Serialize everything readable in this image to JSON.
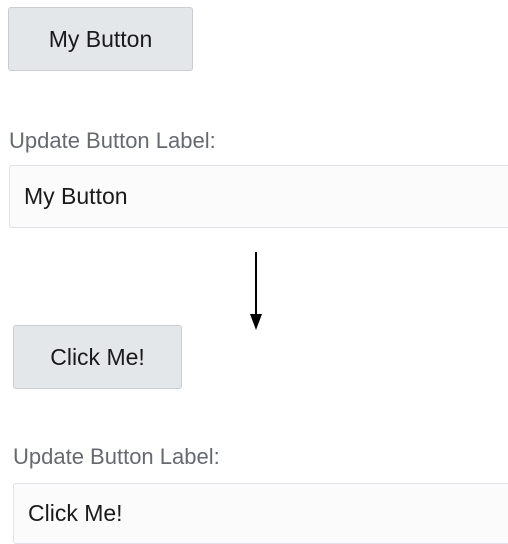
{
  "before": {
    "button_label": "My Button",
    "field_label": "Update Button Label:",
    "field_value": "My Button"
  },
  "after": {
    "button_label": "Click Me!",
    "field_label": "Update Button Label:",
    "field_value": "Click Me!"
  },
  "arrow": {
    "icon": "arrow-down-icon",
    "color": "#000000"
  }
}
